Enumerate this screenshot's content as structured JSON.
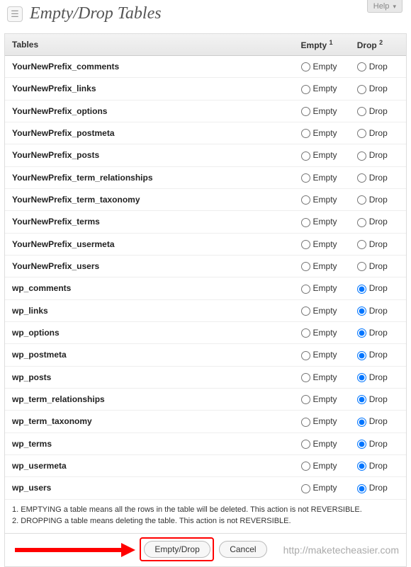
{
  "help_label": "Help",
  "page_title": "Empty/Drop Tables",
  "columns": {
    "tables": "Tables",
    "empty": "Empty",
    "empty_sup": "1",
    "drop": "Drop",
    "drop_sup": "2"
  },
  "row_labels": {
    "empty": "Empty",
    "drop": "Drop"
  },
  "rows": [
    {
      "name": "YourNewPrefix_comments",
      "drop_checked": false
    },
    {
      "name": "YourNewPrefix_links",
      "drop_checked": false
    },
    {
      "name": "YourNewPrefix_options",
      "drop_checked": false
    },
    {
      "name": "YourNewPrefix_postmeta",
      "drop_checked": false
    },
    {
      "name": "YourNewPrefix_posts",
      "drop_checked": false
    },
    {
      "name": "YourNewPrefix_term_relationships",
      "drop_checked": false
    },
    {
      "name": "YourNewPrefix_term_taxonomy",
      "drop_checked": false
    },
    {
      "name": "YourNewPrefix_terms",
      "drop_checked": false
    },
    {
      "name": "YourNewPrefix_usermeta",
      "drop_checked": false
    },
    {
      "name": "YourNewPrefix_users",
      "drop_checked": false
    },
    {
      "name": "wp_comments",
      "drop_checked": true
    },
    {
      "name": "wp_links",
      "drop_checked": true
    },
    {
      "name": "wp_options",
      "drop_checked": true
    },
    {
      "name": "wp_postmeta",
      "drop_checked": true
    },
    {
      "name": "wp_posts",
      "drop_checked": true
    },
    {
      "name": "wp_term_relationships",
      "drop_checked": true
    },
    {
      "name": "wp_term_taxonomy",
      "drop_checked": true
    },
    {
      "name": "wp_terms",
      "drop_checked": true
    },
    {
      "name": "wp_usermeta",
      "drop_checked": true
    },
    {
      "name": "wp_users",
      "drop_checked": true
    }
  ],
  "footnotes": {
    "n1": "1. EMPTYING a table means all the rows in the table will be deleted. This action is not REVERSIBLE.",
    "n2": "2. DROPPING a table means deleting the table. This action is not REVERSIBLE."
  },
  "buttons": {
    "primary": "Empty/Drop",
    "cancel": "Cancel"
  },
  "watermark": "http://maketecheasier.com"
}
